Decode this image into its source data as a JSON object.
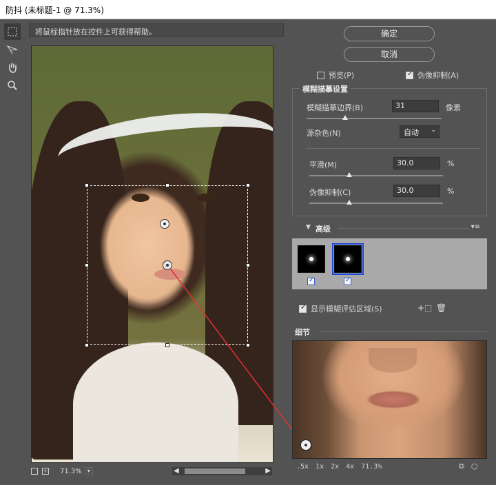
{
  "window": {
    "title": "防抖 (未标题-1 @ 71.3%)"
  },
  "tools": [
    {
      "name": "marquee-tool",
      "glyph": "⬚"
    },
    {
      "name": "blur-trace-tool",
      "glyph": "↗"
    },
    {
      "name": "hand-tool",
      "glyph": "✋"
    },
    {
      "name": "zoom-tool",
      "glyph": "⌕"
    }
  ],
  "hint": "将鼠标指针放在控件上可获得帮助。",
  "canvas": {
    "zoom": "71.3%"
  },
  "buttons": {
    "ok": "确定",
    "cancel": "取消"
  },
  "options": {
    "preview": "预览(P)",
    "artifact": "伪像抑制(A)"
  },
  "blur_trace": {
    "legend": "模糊描摹设置",
    "bounds_label": "模糊描摹边界(B)",
    "bounds_value": "31",
    "bounds_unit": "像素",
    "noise_label": "源杂色(N)",
    "noise_value": "自动",
    "smooth_label": "平滑(M)",
    "smooth_value": "30.0",
    "smooth_unit": "%",
    "artifact_label": "伪像抑制(C)",
    "artifact_value": "30.0",
    "artifact_unit": "%"
  },
  "advanced": {
    "title": "高级",
    "show_eval": "显示模糊评估区域(S)"
  },
  "detail": {
    "title": "细节",
    "zooms": [
      ".5x",
      "1x",
      "2x",
      "4x",
      "71.3%"
    ]
  }
}
